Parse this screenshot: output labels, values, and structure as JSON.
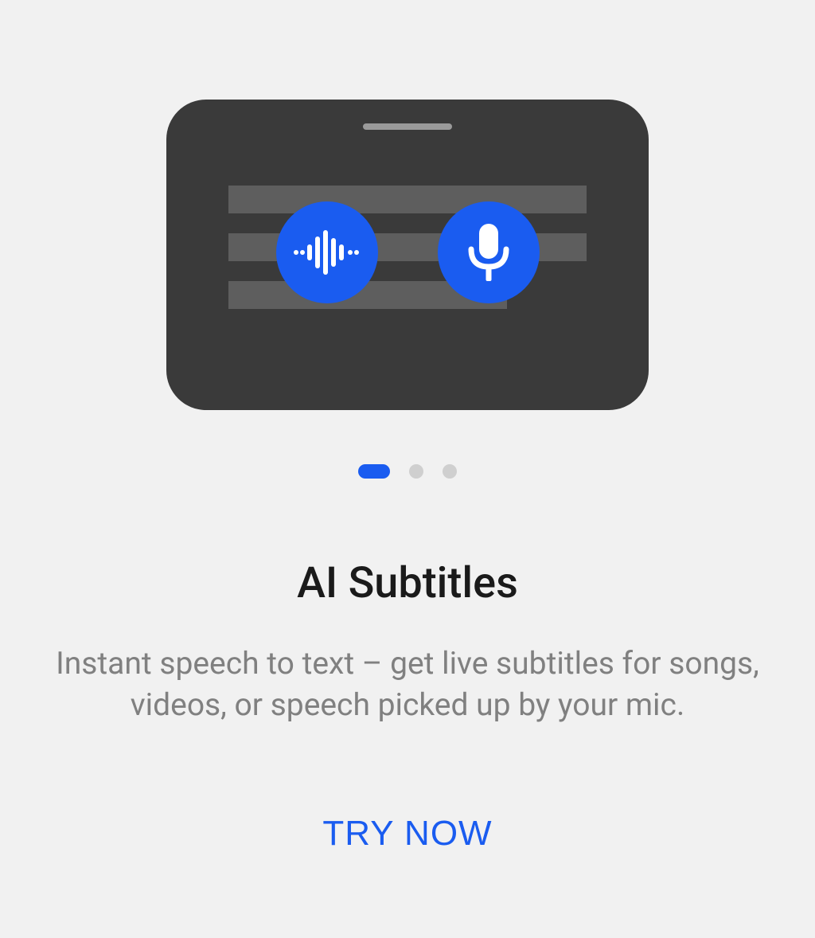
{
  "illustration": {
    "waveform_icon": "waveform-icon",
    "microphone_icon": "microphone-icon"
  },
  "pagination": {
    "active_index": 0,
    "total": 3
  },
  "content": {
    "title": "AI Subtitles",
    "description": "Instant speech to text – get live subtitles for songs, videos, or speech picked up by your mic."
  },
  "cta": {
    "label": "TRY NOW"
  },
  "colors": {
    "accent": "#1a5cf0",
    "background": "#f1f1f1",
    "device": "#3a3a3a"
  }
}
